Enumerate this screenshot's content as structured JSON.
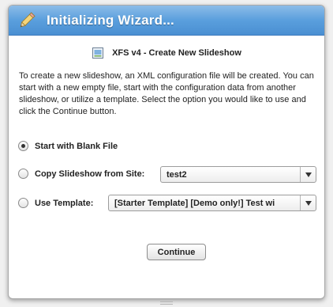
{
  "window": {
    "title": "Initializing Wizard...",
    "title_icon": "pencil-icon"
  },
  "heading": {
    "icon": "document-icon",
    "text": "XFS v4 - Create New Slideshow"
  },
  "description": "To create a new slideshow, an XML configuration file will be created.  You can start with a new empty file, start with the configuration data from another slideshow, or utilize a template. Select the option you would like to use and click the Continue button.",
  "options": {
    "blank": {
      "label": "Start with Blank File",
      "selected": true
    },
    "copy": {
      "label": "Copy Slideshow from Site:",
      "selected": false,
      "value": "test2"
    },
    "template": {
      "label": "Use Template:",
      "selected": false,
      "value": "[Starter Template] [Demo only!] Test wi"
    }
  },
  "continue_label": "Continue",
  "colors": {
    "titlebar": "#5a9fdd",
    "title_text": "#ffffff"
  }
}
